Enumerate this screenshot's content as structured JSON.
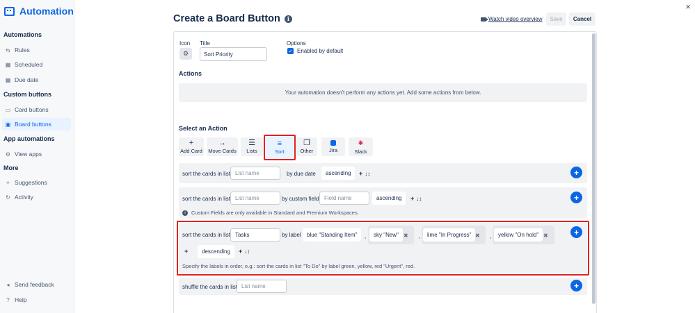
{
  "sidebar": {
    "brand": "Automation",
    "sections": [
      {
        "heading": "Automations"
      },
      {
        "heading": "Custom buttons"
      },
      {
        "heading": "App automations"
      },
      {
        "heading": "More"
      }
    ],
    "items": [
      {
        "label": "Rules",
        "icon": "rules-icon"
      },
      {
        "label": "Scheduled",
        "icon": "calendar-icon"
      },
      {
        "label": "Due date",
        "icon": "calendar-icon"
      },
      {
        "label": "Card buttons",
        "icon": "card-icon"
      },
      {
        "label": "Board buttons",
        "icon": "board-icon",
        "active": true
      },
      {
        "label": "View apps",
        "icon": "gear-icon"
      },
      {
        "label": "Suggestions",
        "icon": "sparkle-icon"
      },
      {
        "label": "Activity",
        "icon": "refresh-icon"
      },
      {
        "label": "Send feedback",
        "icon": "megaphone-icon"
      },
      {
        "label": "Help",
        "icon": "help-icon"
      }
    ]
  },
  "header": {
    "title": "Create a Board Button",
    "video_link": "Watch video overview",
    "save": "Save",
    "cancel": "Cancel"
  },
  "form": {
    "icon_label": "Icon",
    "title_label": "Title",
    "title_value": "Sort Priority",
    "options_label": "Options",
    "enabled_label": "Enabled by default",
    "enabled": true
  },
  "actions": {
    "heading": "Actions",
    "empty_text": "Your automation doesn't perform any actions yet. Add some actions from below."
  },
  "select_action": {
    "heading": "Select an Action",
    "buttons": [
      {
        "label": "Add Card",
        "icon": "plus-icon"
      },
      {
        "label": "Move Cards",
        "icon": "arrow-right-icon"
      },
      {
        "label": "Lists",
        "icon": "list-icon"
      },
      {
        "label": "Sort",
        "icon": "sort-icon",
        "selected": true
      },
      {
        "label": "Other",
        "icon": "copy-icon"
      },
      {
        "label": "Jira",
        "icon": "jira-icon"
      },
      {
        "label": "Slack",
        "icon": "slack-icon"
      }
    ]
  },
  "rows": {
    "due": {
      "prefix": "sort the cards in list",
      "list_placeholder": "List name",
      "by": "by due date",
      "order": "ascending"
    },
    "custom": {
      "prefix": "sort the cards in list",
      "list_placeholder": "List name",
      "by": "by custom field",
      "field_placeholder": "Field name",
      "order": "ascending",
      "note": "Custom Fields are only available in Standard and Premium Workspaces."
    },
    "label": {
      "prefix": "sort the cards in list",
      "list_value": "Tasks",
      "by": "by label",
      "labels": [
        "blue \"Standing Item\"",
        "sky \"New\"",
        "lime \"In Progress\"",
        "yellow \"On hold\""
      ],
      "order": "descending",
      "hint": "Specify the labels in order, e.g.: sort the cards in list \"To Do\" by label green, yellow, red \"Urgent\", red."
    },
    "shuffle": {
      "prefix": "shuffle the cards in list",
      "list_placeholder": "List name"
    }
  },
  "glyphs": {
    "plus": "+",
    "sort": "↓↕",
    "x": "✖",
    "close": "×",
    "comma": ","
  },
  "colors": {
    "accent": "#0c66e4",
    "highlight": "#e02222"
  }
}
